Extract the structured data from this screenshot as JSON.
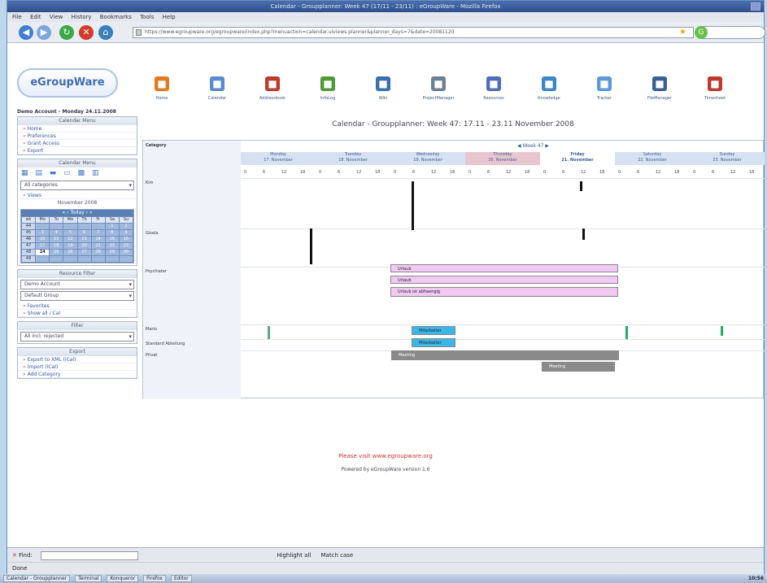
{
  "window": {
    "title": "Calendar - Groupplanner: Week 47 (17/11 - 23/11) : eGroupWare - Mozilla Firefox"
  },
  "menu": [
    "File",
    "Edit",
    "View",
    "History",
    "Bookmarks",
    "Tools",
    "Help"
  ],
  "browser": {
    "url": "https://www.egroupware.org/egroupware/index.php?menuaction=calendar.uiviews.planner&planner_days=7&date=20081120"
  },
  "logo": {
    "text": "eGroupWare"
  },
  "apps": [
    {
      "label": "Home",
      "icon": "home-icon",
      "color": "#e27a1e"
    },
    {
      "label": "Calendar",
      "icon": "calendar-icon",
      "color": "#5a8bd0"
    },
    {
      "label": "Addressbook",
      "icon": "addressbook-icon",
      "color": "#c0392b"
    },
    {
      "label": "InfoLog",
      "icon": "infolog-icon",
      "color": "#4e9a3a"
    },
    {
      "label": "Wiki",
      "icon": "wiki-icon",
      "color": "#3a6fb0"
    },
    {
      "label": "ProjectManager",
      "icon": "projectmanager-icon",
      "color": "#6d7f96"
    },
    {
      "label": "Resources",
      "icon": "resources-icon",
      "color": "#4f6db8"
    },
    {
      "label": "Knowledge",
      "icon": "knowledge-icon",
      "color": "#3d86c6"
    },
    {
      "label": "Tracker",
      "icon": "tracker-icon",
      "color": "#5a9ad6"
    },
    {
      "label": "FileManager",
      "icon": "filemanager-icon",
      "color": "#3a5f96"
    },
    {
      "label": "Timesheet",
      "icon": "timesheet-icon",
      "color": "#c0392b"
    }
  ],
  "user": {
    "line": "Demo Account - Monday 24.11.2008"
  },
  "sidebar": {
    "cal_menu_title": "Calendar Menu",
    "cal_links": [
      "Home",
      "Preferences",
      "Grant Access",
      "Export"
    ],
    "select_title": "Calendar Menu",
    "category_select": "All categories",
    "views_link": "Views",
    "month_label": "November 2008",
    "mini_nav": "« ‹ Today › »",
    "weekday_heads": [
      "wk",
      "Mo",
      "Tu",
      "We",
      "Th",
      "Fr",
      "Sa",
      "Su"
    ],
    "weeks": [
      [
        "44",
        "",
        "",
        "",
        "",
        "",
        "1",
        "2"
      ],
      [
        "45",
        "3",
        "4",
        "5",
        "6",
        "7",
        "8",
        "9"
      ],
      [
        "46",
        "10",
        "11",
        "12",
        "13",
        "14",
        "15",
        "16"
      ],
      [
        "47",
        "17",
        "18",
        "19",
        "20",
        "21",
        "22",
        "23"
      ],
      [
        "48",
        "24",
        "25",
        "26",
        "27",
        "28",
        "29",
        "30"
      ],
      [
        "49",
        "",
        "",
        "",
        "",
        "",
        "",
        ""
      ]
    ],
    "today": "24",
    "user_title": "Resource Filter",
    "user_select": "Demo Account",
    "group_select": "Default Group",
    "user_links": [
      "Favorites",
      "Show all / Cal"
    ],
    "filter_title": "Filter",
    "filter_select": "All incl. rejected",
    "export_title": "Export",
    "export_links": [
      "Export to XML (iCal)",
      "Import (iCal)",
      "Add Category"
    ]
  },
  "calendar": {
    "heading": "Calendar - Groupplanner: Week 47: 17.11 - 23.11 November 2008",
    "nav_week": "Week 47",
    "category_header": "Category",
    "days": [
      {
        "name": "Monday",
        "date": "17. November"
      },
      {
        "name": "Tuesday",
        "date": "18. November"
      },
      {
        "name": "Wednesday",
        "date": "19. November"
      },
      {
        "name": "Thursday",
        "date": "20. November"
      },
      {
        "name": "Friday",
        "date": "21. November"
      },
      {
        "name": "Saturday",
        "date": "22. November"
      },
      {
        "name": "Sunday",
        "date": "23. November"
      }
    ],
    "hours": [
      "0",
      "6",
      "12",
      "18"
    ],
    "rows": [
      {
        "label": "Kim"
      },
      {
        "label": "Gisela"
      },
      {
        "label": "Psychiater"
      },
      {
        "label": "Mario"
      },
      {
        "label": "Standard Abteilung"
      },
      {
        "label": "Privat"
      }
    ],
    "events": [
      {
        "label": "Urlaub",
        "color": "#f2c9f2"
      },
      {
        "label": "Urlaub",
        "color": "#f2c9f2"
      },
      {
        "label": "Urlaub ist abhaengig",
        "color": "#f2c9f2"
      },
      {
        "label": "Mitarbeiter",
        "color": "#39b7e6"
      },
      {
        "label": "Mitarbeiter",
        "color": "#39b7e6"
      },
      {
        "label": "Meeting",
        "color": "#8a8a8a"
      },
      {
        "label": "Meeting",
        "color": "#8a8a8a"
      }
    ]
  },
  "footer": {
    "line1": "Please visit www.egroupware.org",
    "line2": "Powered by eGroupWare version 1.6"
  },
  "findbar": {
    "find_label": "Find:",
    "highlight_label": "Highlight all",
    "match_case": "Match case"
  },
  "status": {
    "text": "Done"
  },
  "taskbar": {
    "items": [
      "Calendar - Groupplanner",
      "Terminal",
      "Konqueror",
      "Firefox",
      "Editor"
    ],
    "clock": "10:56"
  }
}
